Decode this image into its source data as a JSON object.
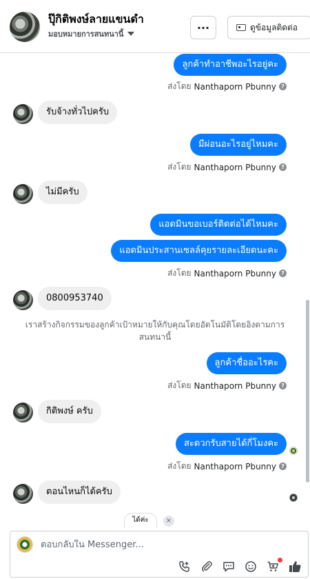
{
  "header": {
    "contact_name": "ปุ๊กิติพงษ์ลายแขนดำ",
    "assignment_label": "มอบหมายการสนทนานี้",
    "more_label": "···",
    "view_contact_label": "ดูข้อมูลติดต่อ"
  },
  "messages": {
    "out1": "ลูกค้าทำอาชีพอะไรอยู่คะ",
    "in1": "รับจ้างทั่วไปครับ",
    "out2": "มีผ่อนอะไรอยู่ไหมคะ",
    "in2": "ไม่มีครับ",
    "out3": "แอดมินขอเบอร์ติดต่อได้ไหมคะ",
    "out4": "แอดมินประสานเซลล์คุยรายละเอียดนะคะ",
    "in3": "0800953740",
    "system_note": "เราสร้างกิจกรรมของลูกค้าเป้าหมายให้กับคุณโดยอัตโนมัติโดยอิงตามการสนทนานี้",
    "out5": "ลูกค้าชื่ออะไรคะ",
    "in4": "กิติพงษ์ ครับ",
    "out6": "สะดวกรับสายได้กี่โมงคะ",
    "in5": "ตอนไหนก็ได้ครับ"
  },
  "sent_by": {
    "prefix": "ส่งโดย",
    "name": "Nanthaporn Pbunny",
    "help": "?"
  },
  "quick_reply": {
    "label": "ได้ค่ะ",
    "close": "×"
  },
  "composer": {
    "placeholder": "ตอบกลับใน Messenger..."
  },
  "colors": {
    "outgoing_bubble": "#0a7cff",
    "incoming_bubble": "#efefef"
  }
}
